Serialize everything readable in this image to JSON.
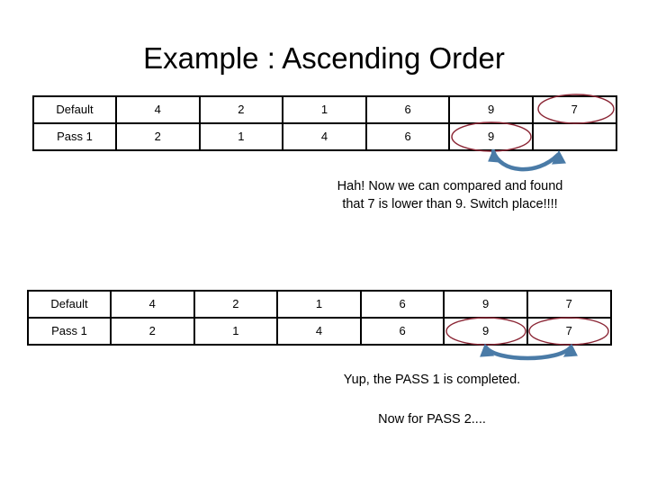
{
  "slide": {
    "title": "Example : Ascending Order",
    "background_color": "#ffffff",
    "text_color": "#000000"
  },
  "annotations": {
    "ellipse_color": "#8B2635",
    "arrow_color": "#4A7BA7"
  },
  "tables": [
    {
      "id": "table-1",
      "rows": [
        {
          "label": "Default",
          "values": [
            "4",
            "2",
            "1",
            "6",
            "9",
            "7"
          ]
        },
        {
          "label": "Pass 1",
          "values": [
            "2",
            "1",
            "4",
            "6",
            "9",
            ""
          ]
        }
      ],
      "highlighted_cells": [
        {
          "row": 0,
          "col": 6
        },
        {
          "row": 1,
          "col": 5
        }
      ]
    },
    {
      "id": "table-2",
      "rows": [
        {
          "label": "Default",
          "values": [
            "4",
            "2",
            "1",
            "6",
            "9",
            "7"
          ]
        },
        {
          "label": "Pass 1",
          "values": [
            "2",
            "1",
            "4",
            "6",
            "9",
            "7"
          ]
        }
      ],
      "highlighted_cells": [
        {
          "row": 1,
          "col": 5
        },
        {
          "row": 1,
          "col": 6
        }
      ]
    }
  ],
  "captions": {
    "middle_line_1": "Hah! Now we can compared and found",
    "middle_line_2": "that 7 is lower than 9. Switch place!!!!",
    "bottom_line_1": "Yup, the PASS 1 is completed.",
    "bottom_line_2": "Now for PASS 2...."
  }
}
